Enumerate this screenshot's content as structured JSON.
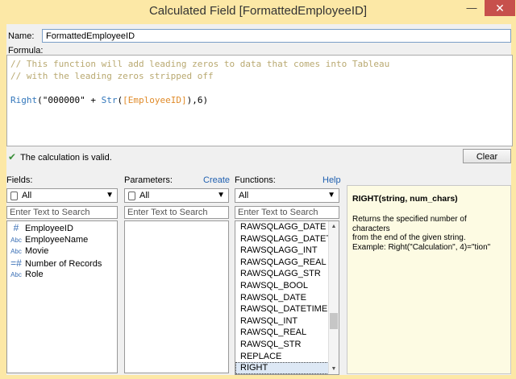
{
  "window": {
    "title": "Calculated Field [FormattedEmployeeID]",
    "minimize": "—",
    "close": "✕"
  },
  "name": {
    "label": "Name:",
    "value": "FormattedEmployeeID"
  },
  "formula": {
    "label": "Formula:",
    "comment1": "// This function will add leading zeros to data that comes into Tableau",
    "comment2": "// with the leading zeros stripped off",
    "fn_right": "Right",
    "str_part": "(\"000000\" + ",
    "fn_str": "Str",
    "paren_open": "(",
    "field": "[EmployeeID]",
    "tail": "),6)"
  },
  "status": {
    "text": "The calculation is valid."
  },
  "clear_label": "Clear",
  "fields": {
    "label": "Fields:",
    "dropdown": "All",
    "search_placeholder": "Enter Text to Search",
    "items": [
      {
        "icon": "#",
        "name": "EmployeeID"
      },
      {
        "icon": "Abc",
        "name": "EmployeeName"
      },
      {
        "icon": "Abc",
        "name": "Movie"
      },
      {
        "icon": "=#",
        "name": "Number of Records"
      },
      {
        "icon": "Abc",
        "name": "Role"
      }
    ]
  },
  "parameters": {
    "label": "Parameters:",
    "create_link": "Create",
    "dropdown": "All",
    "search_placeholder": "Enter Text to Search"
  },
  "functions": {
    "label": "Functions:",
    "help_link": "Help",
    "dropdown": "All",
    "search_placeholder": "Enter Text to Search",
    "items": [
      "RAWSQLAGG_DATE",
      "RAWSQLAGG_DATET...",
      "RAWSQLAGG_INT",
      "RAWSQLAGG_REAL",
      "RAWSQLAGG_STR",
      "RAWSQL_BOOL",
      "RAWSQL_DATE",
      "RAWSQL_DATETIME",
      "RAWSQL_INT",
      "RAWSQL_REAL",
      "RAWSQL_STR",
      "REPLACE",
      "RIGHT"
    ],
    "selected": "RIGHT"
  },
  "help": {
    "signature": "RIGHT(string, num_chars)",
    "line1": "Returns the specified number of characters",
    "line2": "from the end of the given string.",
    "line3": "Example: Right(\"Calculation\", 4)=\"tion\""
  }
}
